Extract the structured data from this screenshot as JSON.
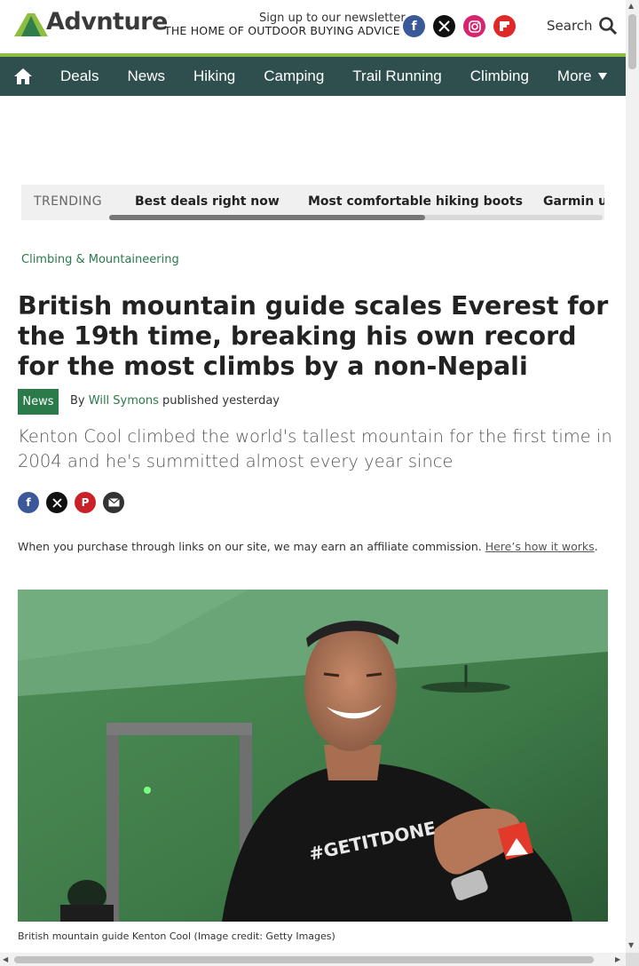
{
  "header": {
    "logo": "Advnture",
    "tagline": "THE HOME OF OUTDOOR BUYING ADVICE",
    "newsletter": "Sign up to our newsletter",
    "search_label": "Search",
    "social_icons": [
      "facebook-icon",
      "x-icon",
      "instagram-icon",
      "flipboard-icon"
    ],
    "brand_green": "#8dbe3f"
  },
  "nav": {
    "background": "#2f4f4f",
    "items": [
      "Deals",
      "News",
      "Hiking",
      "Camping",
      "Trail Running",
      "Climbing",
      "More"
    ]
  },
  "trending": {
    "label": "TRENDING",
    "items": [
      "Best deals right now",
      "Most comfortable hiking boots",
      "Garmin up"
    ]
  },
  "article": {
    "breadcrumb": "Climbing & Mountaineering",
    "title": "British mountain guide scales Everest for the 19th time, breaking his own record for the most climbs by a non-Nepali",
    "badge": "News",
    "by": "By",
    "author": "Will Symons",
    "published": "published yesterday",
    "standfirst": "Kenton Cool climbed the world's tallest mountain for the first time in 2004 and he's summitted almost every year since",
    "share_icons": [
      "facebook-icon",
      "x-icon",
      "pinterest-icon",
      "email-icon"
    ],
    "affiliate_text": "When you purchase through links on our site, we may earn an affiliate commission.",
    "affiliate_link": "Here’s how it works",
    "affiliate_period": ".",
    "image_text": "#GETITDONE",
    "caption": "British mountain guide Kenton Cool",
    "credit": "(Image credit: Getty Images)",
    "accent_green": "#2a7a4a"
  }
}
